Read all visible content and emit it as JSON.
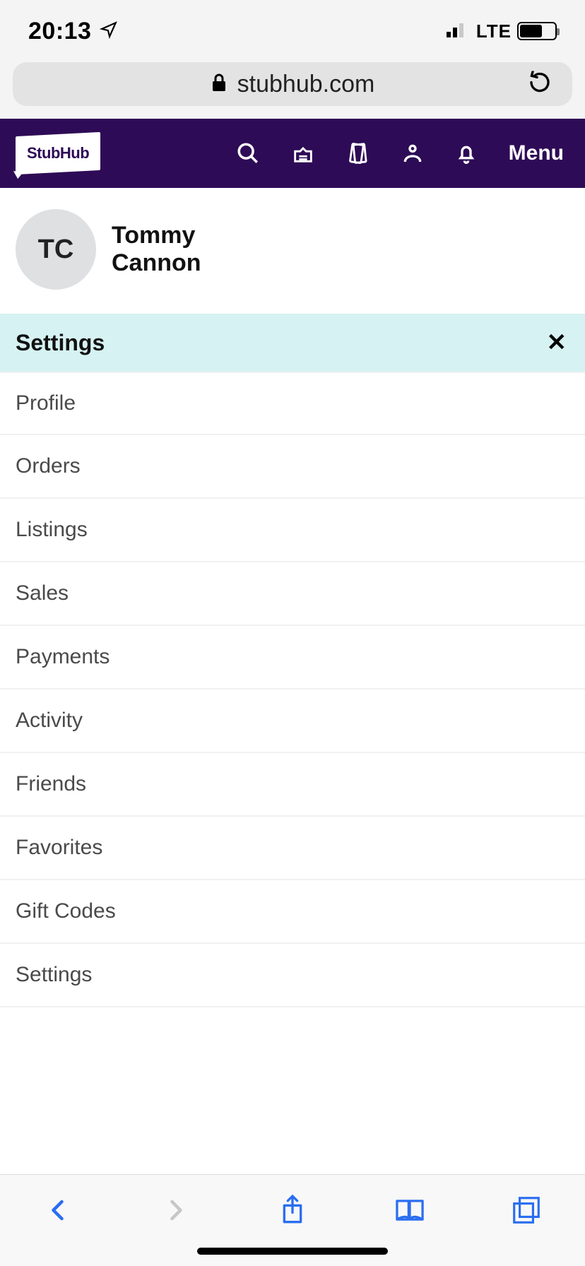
{
  "status": {
    "time": "20:13",
    "network": "LTE"
  },
  "browser": {
    "domain": "stubhub.com"
  },
  "header": {
    "brand": "StubHub",
    "menu_label": "Menu"
  },
  "profile": {
    "initials": "TC",
    "name_line1": "Tommy",
    "name_line2": "Cannon"
  },
  "settings": {
    "title": "Settings",
    "items": [
      "Profile",
      "Orders",
      "Listings",
      "Sales",
      "Payments",
      "Activity",
      "Friends",
      "Favorites",
      "Gift Codes",
      "Settings"
    ]
  }
}
